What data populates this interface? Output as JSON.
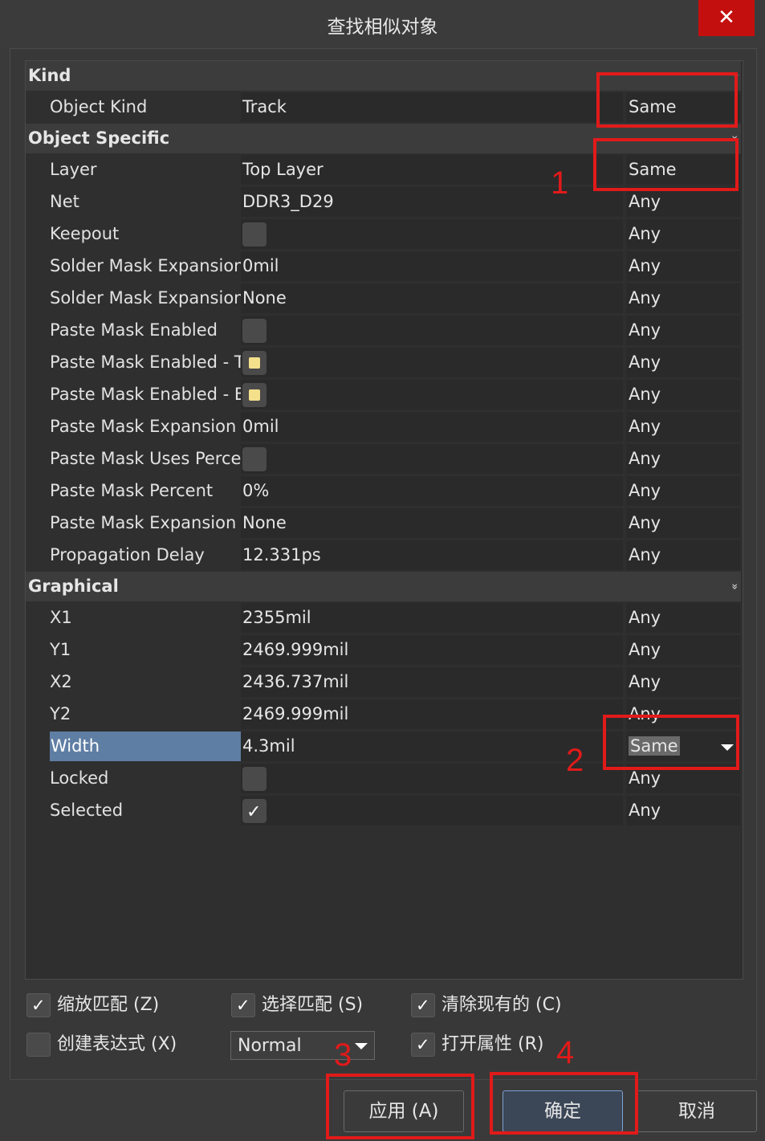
{
  "window": {
    "title": "查找相似对象",
    "close_glyph": "✕"
  },
  "sections": {
    "kind": "Kind",
    "object_specific": "Object Specific",
    "graphical": "Graphical"
  },
  "chevron_glyph": "»",
  "rows": {
    "object_kind": {
      "name": "Object Kind",
      "value": "Track",
      "cond": "Same"
    },
    "layer": {
      "name": "Layer",
      "value": "Top Layer",
      "cond": "Same"
    },
    "net": {
      "name": "Net",
      "value": "DDR3_D29",
      "cond": "Any"
    },
    "keepout": {
      "name": "Keepout",
      "cond": "Any"
    },
    "sme": {
      "name": "Solder Mask Expansion",
      "value": "0mil",
      "cond": "Any"
    },
    "sme_mode": {
      "name": "Solder Mask Expansion M",
      "value": "None",
      "cond": "Any"
    },
    "pme": {
      "name": "Paste Mask Enabled",
      "cond": "Any"
    },
    "pme_top": {
      "name": "Paste Mask Enabled - To",
      "cond": "Any"
    },
    "pme_bottom": {
      "name": "Paste Mask Enabled - Bo",
      "cond": "Any"
    },
    "pmx": {
      "name": "Paste Mask Expansion",
      "value": "0mil",
      "cond": "Any"
    },
    "pmup": {
      "name": "Paste Mask Uses Percent",
      "cond": "Any"
    },
    "pmp": {
      "name": "Paste Mask Percent",
      "value": "0%",
      "cond": "Any"
    },
    "pmxm": {
      "name": "Paste Mask Expansion M",
      "value": "None",
      "cond": "Any"
    },
    "pd": {
      "name": "Propagation Delay",
      "value": "12.331ps",
      "cond": "Any"
    },
    "x1": {
      "name": "X1",
      "value": "2355mil",
      "cond": "Any"
    },
    "y1": {
      "name": "Y1",
      "value": "2469.999mil",
      "cond": "Any"
    },
    "x2": {
      "name": "X2",
      "value": "2436.737mil",
      "cond": "Any"
    },
    "y2": {
      "name": "Y2",
      "value": "2469.999mil",
      "cond": "Any"
    },
    "width": {
      "name": "Width",
      "value": "4.3mil",
      "cond": "Same"
    },
    "locked": {
      "name": "Locked",
      "cond": "Any"
    },
    "selected": {
      "name": "Selected",
      "cond": "Any"
    }
  },
  "options": {
    "zoom_match": "缩放匹配 (Z)",
    "select_match": "选择匹配 (S)",
    "clear_existing": "清除现有的 (C)",
    "create_expression": "创建表达式 (X)",
    "open_properties": "打开属性 (R)",
    "mode_select": "Normal"
  },
  "buttons": {
    "apply": "应用 (A)",
    "ok": "确定",
    "cancel": "取消"
  },
  "annotations": {
    "n1": "1",
    "n2": "2",
    "n3": "3",
    "n4": "4"
  },
  "colors": {
    "annotation_red": "#e11a1a",
    "selection_blue": "#5f7ea4",
    "close_red": "#c40f0f"
  }
}
